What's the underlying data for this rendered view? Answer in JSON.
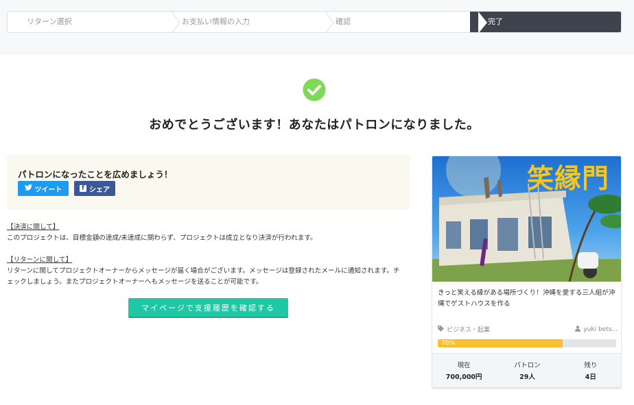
{
  "steps": [
    {
      "label": "リターン選択"
    },
    {
      "label": "お支払い情報の入力"
    },
    {
      "label": "確認"
    },
    {
      "label": "完了"
    }
  ],
  "success": {
    "title": "おめでとうございます！あなたはパトロンになりました。",
    "icon": "check-circle-icon"
  },
  "share": {
    "title": "パトロンになったことを広めましょう！",
    "tweet_label": "ツイート",
    "share_label": "シェア",
    "fb_glyph": "f"
  },
  "notes": {
    "settlement_heading": "【決済に関して】",
    "settlement_text": "このプロジェクトは、目標金額の達成/未達成に関わらず、プロジェクトは成立となり決済が行われます。",
    "return_heading": "【リターンに関して】",
    "return_text": "リターンに関してプロジェクトオーナーからメッセージが届く場合がございます。メッセージは登録されたメールに通知されます。チェックしましょう。またプロジェクトオーナーへもメッセージを送ることが可能です。"
  },
  "cta": {
    "label": "マイページで支援履歴を確認する"
  },
  "project": {
    "image_text": "笑縁門",
    "title": "きっと笑える縁がある場所づくり！沖縄を愛する三人組が沖縄でゲストハウスを作る",
    "category": "ビジネス・起業",
    "owner": "yuki bets...",
    "progress_label": "70%",
    "progress": 0.7,
    "stats": [
      {
        "key": "現在",
        "value": "700,000円"
      },
      {
        "key": "パトロン",
        "value": "29人"
      },
      {
        "key": "残り",
        "value": "4日"
      }
    ]
  },
  "colors": {
    "accent_green": "#1ec8a5",
    "check_green": "#7ed957",
    "twitter": "#1d9bf0",
    "facebook": "#3b5998",
    "progress": "#f5c12e"
  }
}
